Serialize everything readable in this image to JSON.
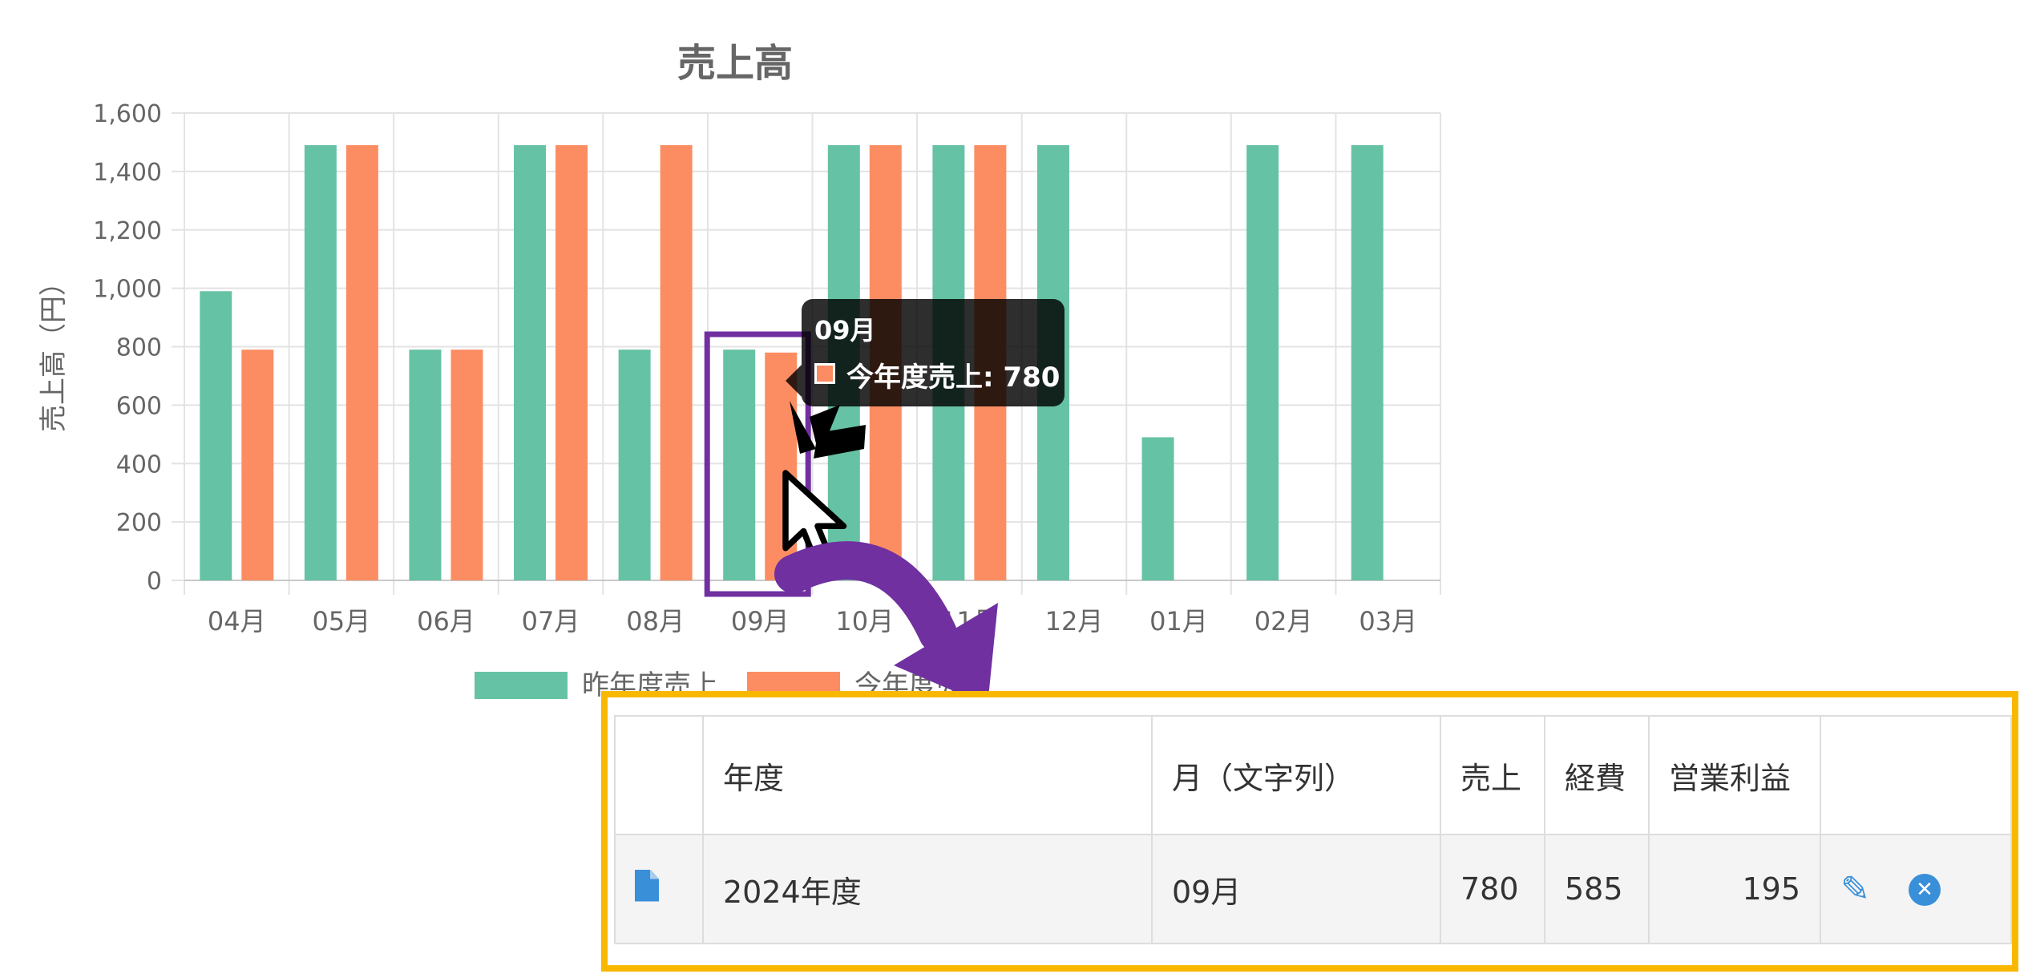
{
  "chart_data": {
    "type": "bar",
    "title": "売上高",
    "ylabel": "売上高（円）",
    "xlabel": "",
    "ylim": [
      0,
      1600
    ],
    "yticks": [
      0,
      200,
      400,
      600,
      800,
      1000,
      1200,
      1400,
      1600
    ],
    "categories": [
      "04月",
      "05月",
      "06月",
      "07月",
      "08月",
      "09月",
      "10月",
      "11月",
      "12月",
      "01月",
      "02月",
      "03月"
    ],
    "series": [
      {
        "name": "昨年度売上",
        "color": "#66c2a5",
        "values": [
          990,
          1490,
          790,
          1490,
          790,
          790,
          1490,
          1490,
          1490,
          490,
          1490,
          1490
        ]
      },
      {
        "name": "今年度売上",
        "color": "#fc8d62",
        "values": [
          790,
          1490,
          790,
          1490,
          1490,
          780,
          1490,
          1490,
          null,
          null,
          null,
          null
        ]
      }
    ],
    "grid": true,
    "legend": "bottom",
    "highlight_category": "09月",
    "highlight_color": "#7030a0"
  },
  "tooltip": {
    "title": "09月",
    "line": "今年度売上: 780"
  },
  "table": {
    "headers": [
      "",
      "年度",
      "月（文字列）",
      "売上",
      "経費",
      "営業利益",
      ""
    ],
    "row": {
      "icon": "file-icon",
      "year": "2024年度",
      "month": "09月",
      "sales": "780",
      "expense": "585",
      "profit": "195",
      "edit_icon": "pencil-icon",
      "delete_icon": "close-circle-icon"
    }
  },
  "colors": {
    "panel_border": "#f9b800",
    "arrow": "#7030a0",
    "icon_blue": "#3a8fd9"
  }
}
